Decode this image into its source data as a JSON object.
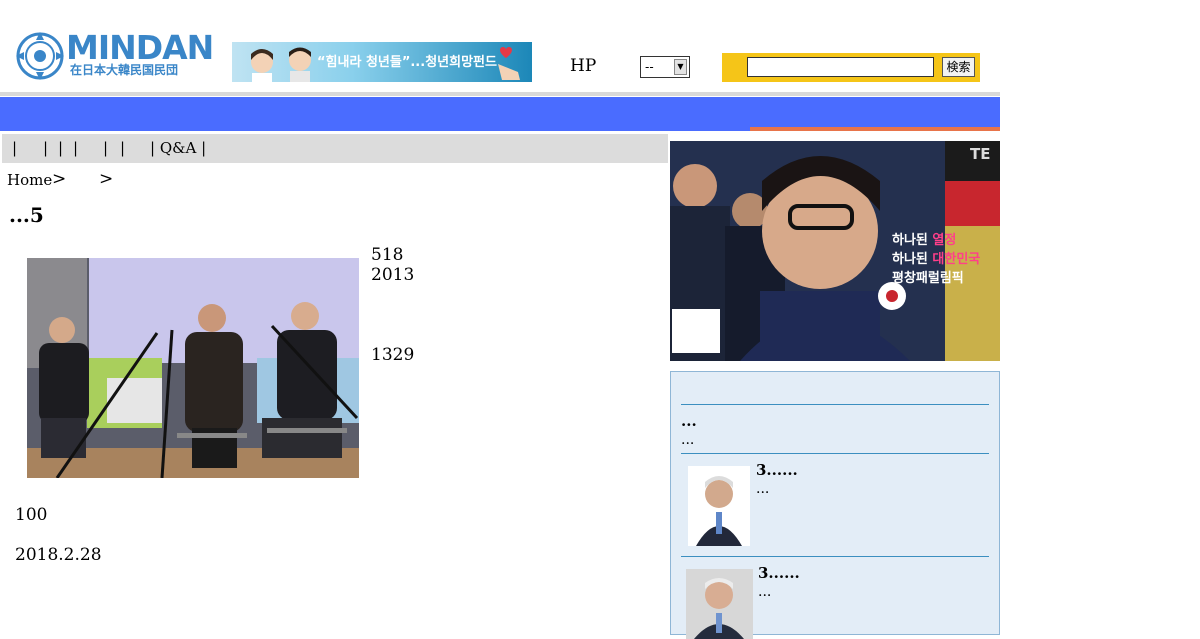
{
  "header": {
    "logo_text": "MINDAN",
    "logo_sub": "在日本大韓民国民団",
    "banner_text": "“힘내라 청년들”...청년희망펀드",
    "hp_label": "HP",
    "select_value": "--",
    "search_placeholder": "",
    "search_button": "検索"
  },
  "subnav": {
    "items": [
      "|",
      "|",
      "|",
      "|",
      "|",
      "|",
      "| Q&A |"
    ]
  },
  "breadcrumb": {
    "home": "Home",
    "sep1": ">",
    "sep2": ">"
  },
  "article": {
    "title": "...5",
    "meta1": "518",
    "meta2": "2013",
    "meta3": "1329",
    "para": "100",
    "date": "2018.2.28"
  },
  "hero": {
    "line1a": "하나된 ",
    "line1b": "열정",
    "line2a": "하나된 ",
    "line2b": "대한민국",
    "line3": "평창패럴림픽",
    "corner": "TE"
  },
  "sidebar": {
    "item1_title": "...",
    "item1_desc": "...",
    "item2_title": "3......",
    "item2_desc": "...",
    "item3_title": "3......",
    "item3_desc": "..."
  },
  "colors": {
    "nav_blue": "#4a6cff",
    "nav_orange": "#e8744a",
    "search_yellow": "#f5c518",
    "sidebar_bg": "#e3edf7"
  }
}
